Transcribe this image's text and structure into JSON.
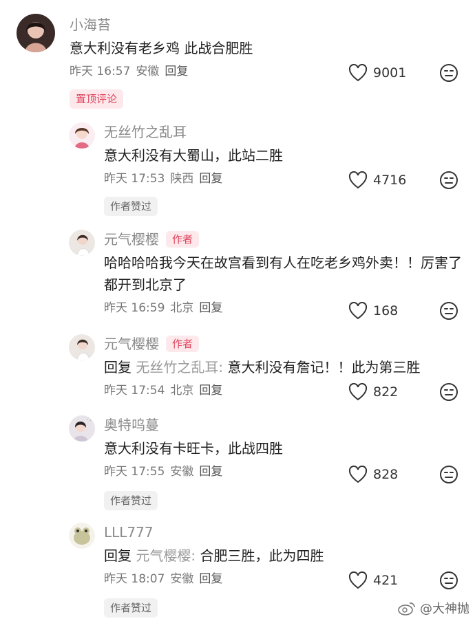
{
  "comments": [
    {
      "username": "小海苔",
      "text": "意大利没有老乡鸡 此战合肥胜",
      "time": "昨天 16:57",
      "location": "安徽",
      "reply_label": "回复",
      "likes": "9001",
      "tag": "置顶评论"
    },
    {
      "username": "无丝竹之乱耳",
      "text": "意大利没有大蜀山，此站二胜",
      "time": "昨天 17:53",
      "location": "陕西",
      "reply_label": "回复",
      "likes": "4716",
      "tag": "作者赞过"
    },
    {
      "username": "元气樱樱",
      "author_badge": "作者",
      "text": "哈哈哈哈我今天在故宫看到有人在吃老乡鸡外卖！！厉害了都开到北京了",
      "time": "昨天 16:59",
      "location": "北京",
      "reply_label": "回复",
      "likes": "168"
    },
    {
      "username": "元气樱樱",
      "author_badge": "作者",
      "reply_prefix": "回复",
      "reply_to": "无丝竹之乱耳:",
      "text": "意大利没有詹记！！此为第三胜",
      "time": "昨天 17:54",
      "location": "北京",
      "reply_label": "回复",
      "likes": "822"
    },
    {
      "username": "奥特呜蔓",
      "text": "意大利没有卡旺卡，此战四胜",
      "time": "昨天 17:55",
      "location": "安徽",
      "reply_label": "回复",
      "likes": "828",
      "tag": "作者赞过"
    },
    {
      "username": "LLL777",
      "reply_prefix": "回复",
      "reply_to": "元气樱樱:",
      "text": "合肥三胜，此为四胜",
      "time": "昨天 18:07",
      "location": "安徽",
      "reply_label": "回复",
      "likes": "421",
      "tag": "作者赞过"
    }
  ],
  "watermark": "@大神抛",
  "colors": {
    "accent": "#e0455d",
    "muted": "#8a8a8a"
  },
  "icons": {
    "like": "heart-outline-icon",
    "dislike": "meh-face-icon"
  }
}
